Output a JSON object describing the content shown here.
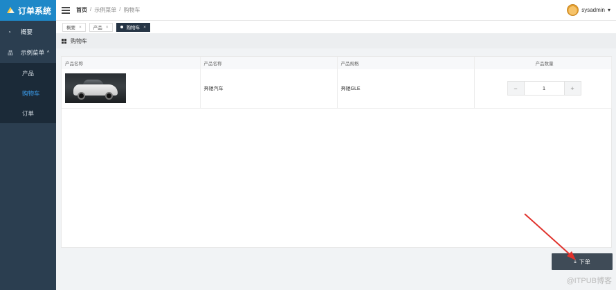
{
  "app": {
    "title": "订单系统"
  },
  "sidebar": {
    "items": [
      {
        "label": "概要",
        "icon": "dashboard-icon"
      },
      {
        "label": "示例菜单",
        "icon": "sitemap-icon",
        "expanded": true
      }
    ],
    "subitems": [
      {
        "label": "产品",
        "active": false
      },
      {
        "label": "购物车",
        "active": true
      },
      {
        "label": "订单",
        "active": false
      }
    ]
  },
  "header": {
    "breadcrumb": [
      "首页",
      "/",
      "示例菜单",
      "/",
      "购物车"
    ],
    "user": "sysadmin"
  },
  "tabs": [
    {
      "label": "概要",
      "active": false
    },
    {
      "label": "产品",
      "active": false
    },
    {
      "label": "购物车",
      "active": true
    }
  ],
  "panel": {
    "title": "购物车"
  },
  "table": {
    "columns": [
      "产品名称",
      "产品名称",
      "产品规格",
      "产品数量"
    ],
    "rows": [
      {
        "image": "car-image",
        "name": "奔驰汽车",
        "spec": "奔驰GLE",
        "quantity": "1"
      }
    ]
  },
  "actions": {
    "order_label": "下单"
  },
  "watermark": "@ITPUB博客",
  "colors": {
    "sidebar": "#2b3e50",
    "logo_bg": "#1e88c8",
    "active_link": "#3b9ded",
    "annotation_arrow": "#e0312b"
  }
}
